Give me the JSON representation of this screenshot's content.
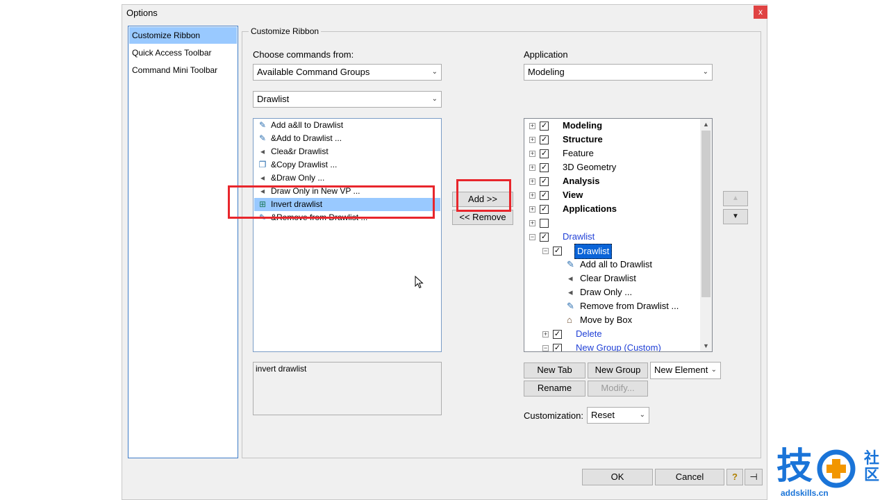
{
  "window": {
    "title": "Options",
    "close_glyph": "x"
  },
  "nav": {
    "items": [
      "Customize Ribbon",
      "Quick Access Toolbar",
      "Command Mini Toolbar"
    ],
    "selected": 0
  },
  "group": {
    "title": "Customize Ribbon"
  },
  "left": {
    "choose_label": "Choose commands from:",
    "choose_value": "Available Command Groups",
    "group_value": "Drawlist",
    "commands": [
      {
        "label": "Add a&ll to Drawlist",
        "icon": "add-all-icon"
      },
      {
        "label": "&Add to Drawlist ...",
        "icon": "add-icon"
      },
      {
        "label": "Clea&r Drawlist",
        "icon": "clear-icon"
      },
      {
        "label": "&Copy Drawlist ...",
        "icon": "copy-icon"
      },
      {
        "label": "&Draw Only ...",
        "icon": "draw-only-icon"
      },
      {
        "label": "Draw Only in New VP ...",
        "icon": "draw-vp-icon"
      },
      {
        "label": "Invert drawlist",
        "icon": "invert-icon"
      },
      {
        "label": "&Remove from Drawlist ...",
        "icon": "remove-icon"
      }
    ],
    "selected_index": 6,
    "description": "invert drawlist"
  },
  "mid": {
    "add_label": "Add >>",
    "remove_label": "<< Remove"
  },
  "right": {
    "application_label": "Application",
    "application_value": "Modeling",
    "tree": [
      {
        "label": "Modeling",
        "style": "bold",
        "level": 0,
        "pm": "+",
        "checked": true
      },
      {
        "label": "Structure",
        "style": "bold",
        "level": 0,
        "pm": "+",
        "checked": true
      },
      {
        "label": "Feature",
        "style": "normal",
        "level": 0,
        "pm": "+",
        "checked": true
      },
      {
        "label": "3D Geometry",
        "style": "normal",
        "level": 0,
        "pm": "+",
        "checked": true
      },
      {
        "label": "Analysis",
        "style": "bold",
        "level": 0,
        "pm": "+",
        "checked": true
      },
      {
        "label": "View",
        "style": "bold",
        "level": 0,
        "pm": "+",
        "checked": true
      },
      {
        "label": "Applications",
        "style": "bold",
        "level": 0,
        "pm": "+",
        "checked": true
      },
      {
        "label": "",
        "style": "normal",
        "level": 0,
        "pm": "+",
        "checked": false
      },
      {
        "label": "Drawlist",
        "style": "blue",
        "level": 0,
        "pm": "-",
        "checked": true
      },
      {
        "label": "Drawlist",
        "style": "selected",
        "level": 1,
        "pm": "-",
        "checked": true
      },
      {
        "label": "Add all to Drawlist",
        "style": "normal",
        "level": 2,
        "icon": "add-all-icon"
      },
      {
        "label": "Clear Drawlist",
        "style": "normal",
        "level": 2,
        "icon": "clear-icon"
      },
      {
        "label": "Draw Only ...",
        "style": "normal",
        "level": 2,
        "icon": "draw-only-icon"
      },
      {
        "label": "Remove from Drawlist ...",
        "style": "normal",
        "level": 2,
        "icon": "remove-icon"
      },
      {
        "label": "Move by Box",
        "style": "normal",
        "level": 2,
        "icon": "move-box-icon"
      },
      {
        "label": "Delete",
        "style": "blue",
        "level": 1,
        "pm": "+",
        "checked": true
      },
      {
        "label": "New Group (Custom)",
        "style": "blue",
        "level": 1,
        "pm": "-",
        "checked": true
      }
    ],
    "new_tab": "New Tab",
    "new_group": "New Group",
    "new_element": "New Element",
    "rename": "Rename",
    "modify": "Modify...",
    "customization_label": "Customization:",
    "customization_value": "Reset"
  },
  "footer": {
    "ok": "OK",
    "cancel": "Cancel",
    "help_glyph": "?",
    "pin_glyph": "⊣"
  },
  "watermark": {
    "brand": "技",
    "side": "社区",
    "url": "addskills.cn"
  },
  "colors": {
    "selection": "#99c9ff",
    "highlight_box": "#e8262c",
    "link_blue": "#1f3fd6",
    "brand_blue": "#1a74d8"
  }
}
